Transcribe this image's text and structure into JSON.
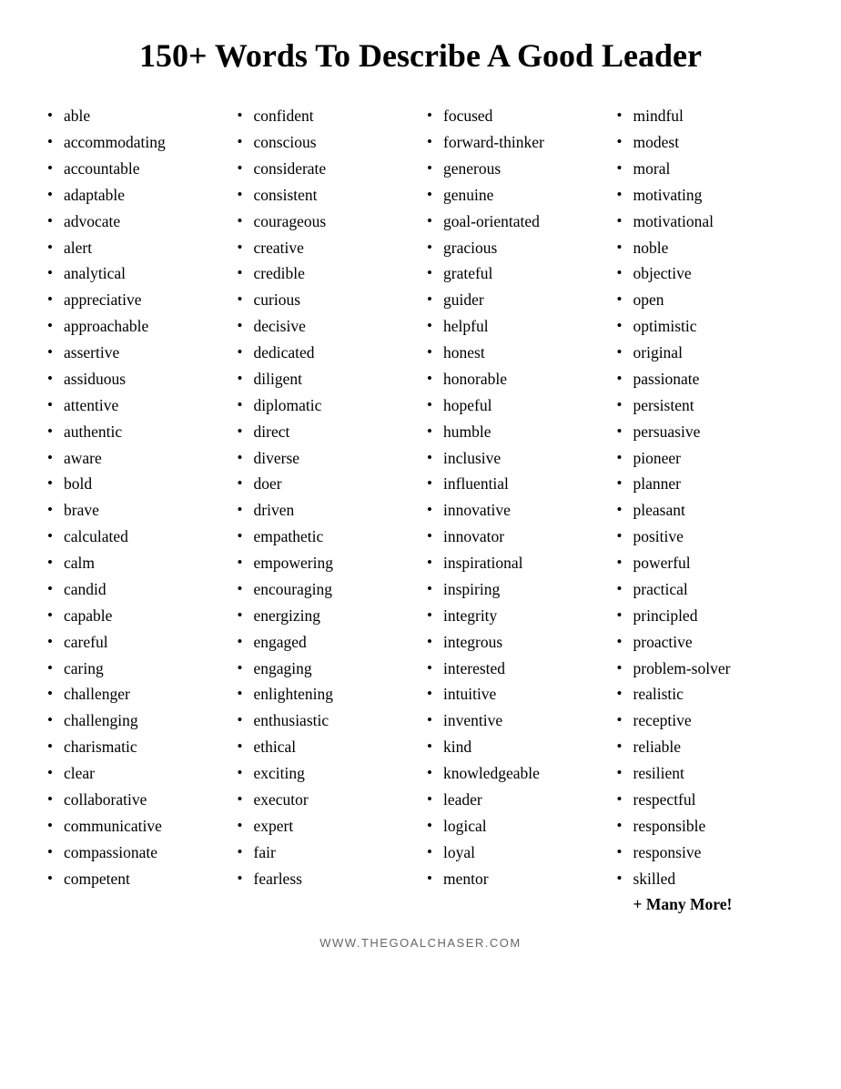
{
  "title": "150+ Words To Describe A Good Leader",
  "columns": [
    {
      "id": "col1",
      "items": [
        "able",
        "accommodating",
        "accountable",
        "adaptable",
        "advocate",
        "alert",
        "analytical",
        "appreciative",
        "approachable",
        "assertive",
        "assiduous",
        "attentive",
        "authentic",
        "aware",
        "bold",
        "brave",
        "calculated",
        "calm",
        "candid",
        "capable",
        "careful",
        "caring",
        "challenger",
        "challenging",
        "charismatic",
        "clear",
        "collaborative",
        "communicative",
        "compassionate",
        "competent"
      ]
    },
    {
      "id": "col2",
      "items": [
        "confident",
        "conscious",
        "considerate",
        "consistent",
        "courageous",
        "creative",
        "credible",
        "curious",
        "decisive",
        "dedicated",
        "diligent",
        "diplomatic",
        "direct",
        "diverse",
        "doer",
        "driven",
        "empathetic",
        "empowering",
        "encouraging",
        "energizing",
        "engaged",
        "engaging",
        "enlightening",
        "enthusiastic",
        "ethical",
        "exciting",
        "executor",
        "expert",
        "fair",
        "fearless"
      ]
    },
    {
      "id": "col3",
      "items": [
        "focused",
        "forward-thinker",
        "generous",
        "genuine",
        "goal-orientated",
        "gracious",
        "grateful",
        "guider",
        "helpful",
        "honest",
        "honorable",
        "hopeful",
        "humble",
        "inclusive",
        "influential",
        "innovative",
        "innovator",
        "inspirational",
        "inspiring",
        "integrity",
        "integrous",
        "interested",
        "intuitive",
        "inventive",
        "kind",
        "knowledgeable",
        "leader",
        "logical",
        "loyal",
        "mentor"
      ]
    },
    {
      "id": "col4",
      "items": [
        "mindful",
        "modest",
        "moral",
        "motivating",
        "motivational",
        "noble",
        "objective",
        "open",
        "optimistic",
        "original",
        "passionate",
        "persistent",
        "persuasive",
        "pioneer",
        "planner",
        "pleasant",
        "positive",
        "powerful",
        "practical",
        "principled",
        "proactive",
        "problem-solver",
        "realistic",
        "receptive",
        "reliable",
        "resilient",
        "respectful",
        "responsible",
        "responsive",
        "skilled"
      ]
    }
  ],
  "extra": "+ Many More!",
  "footer": "WWW.THEGOALCHASER.COM"
}
